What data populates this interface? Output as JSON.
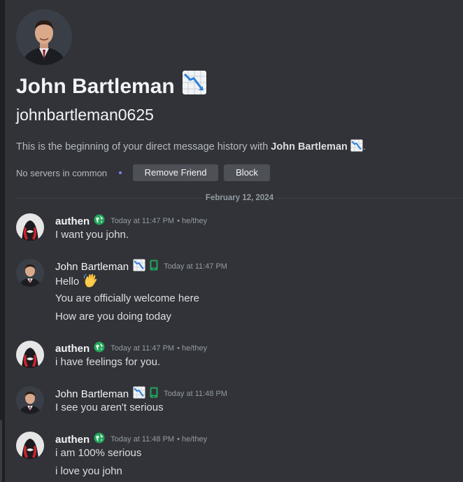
{
  "profile": {
    "display_name": "John Bartleman",
    "username": "johnbartleman0625",
    "intro_prefix": "This is the beginning of your direct message history with ",
    "intro_suffix": ".",
    "mutual_servers": "No servers in common",
    "remove_friend_label": "Remove Friend",
    "block_label": "Block",
    "name_badge_icon": "chart-decreasing-icon"
  },
  "divider": {
    "date": "February 12, 2024"
  },
  "messages": [
    {
      "author": "authen",
      "badge_icon": "globe-icon",
      "timestamp": "Today at 11:47 PM",
      "pronouns": "• he/they",
      "lines": [
        "I want you john."
      ]
    },
    {
      "author": "John Bartleman",
      "badge_icon": "mobile-phone-icon",
      "timestamp": "Today at 11:47 PM",
      "lines": [
        "Hello",
        "You are officially welcome here",
        "How are you doing today"
      ]
    },
    {
      "author": "authen",
      "badge_icon": "globe-icon",
      "timestamp": "Today at 11:47 PM",
      "pronouns": "• he/they",
      "lines": [
        "i have feelings for you."
      ]
    },
    {
      "author": "John Bartleman",
      "badge_icon": "mobile-phone-icon",
      "timestamp": "Today at 11:48 PM",
      "lines": [
        "I see you aren't serious"
      ]
    },
    {
      "author": "authen",
      "badge_icon": "globe-icon",
      "timestamp": "Today at 11:48 PM",
      "pronouns": "• he/they",
      "lines": [
        "i am 100% serious",
        "i love you john"
      ]
    }
  ],
  "colors": {
    "background": "#313338",
    "button": "#4e5058",
    "online_green": "#23a55a",
    "muted_text": "#949ba4"
  }
}
